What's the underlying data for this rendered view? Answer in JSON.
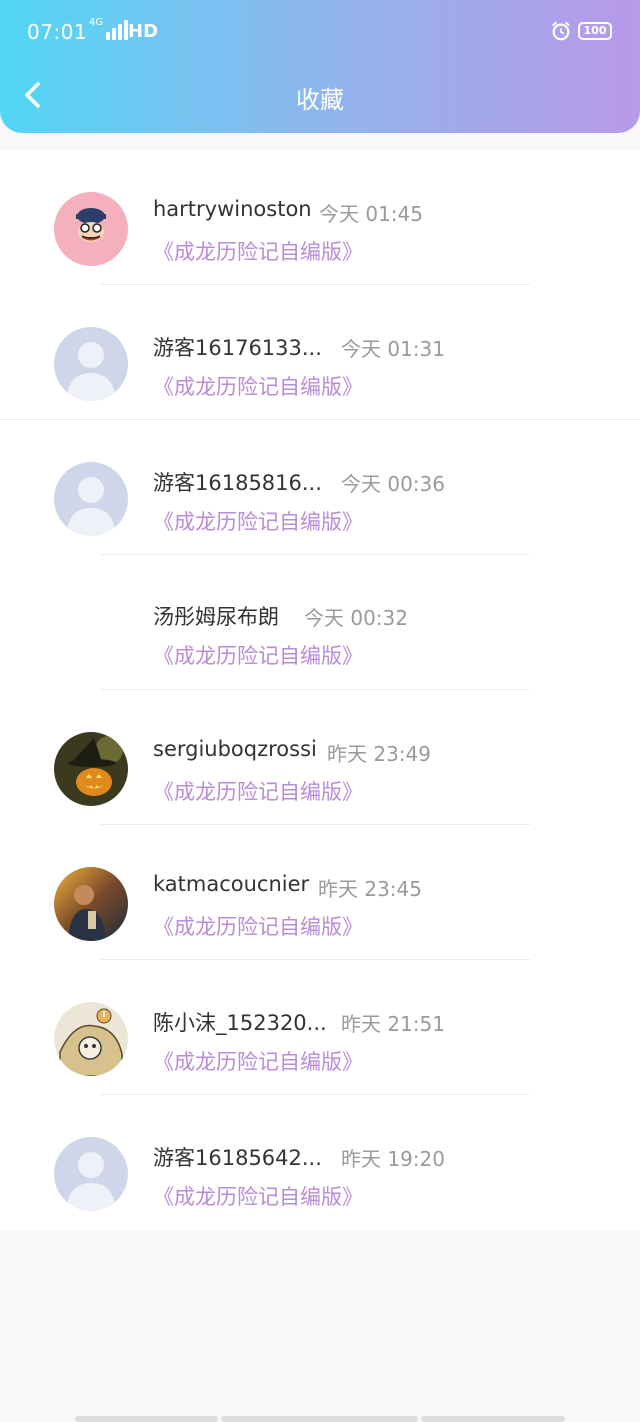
{
  "status_bar": {
    "time": "07:01",
    "network": "4G",
    "hd": "HD",
    "battery": "100"
  },
  "header": {
    "title": "收藏",
    "back_icon": "chevron-left-icon",
    "gradient_start": "#52d7f4",
    "gradient_end": "#b899ea"
  },
  "favorites": [
    {
      "name": "hartrywinoston",
      "time": "今天 01:45",
      "book": "《成龙历险记自编版》",
      "avatar": "cartoon-monkey-avatar"
    },
    {
      "name": "游客16176133...",
      "time": "今天 01:31",
      "book": "《成龙历险记自编版》",
      "avatar": "default-user-avatar"
    },
    {
      "name": "游客16185816...",
      "time": "今天 00:36",
      "book": "《成龙历险记自编版》",
      "avatar": "default-user-avatar"
    },
    {
      "name": "汤彤姆尿布朗",
      "time": "今天 00:32",
      "book": "《成龙历险记自编版》",
      "avatar": ""
    },
    {
      "name": "sergiuboqzrossi",
      "time": "昨天 23:49",
      "book": "《成龙历险记自编版》",
      "avatar": "pumpkin-witch-avatar"
    },
    {
      "name": "katmacoucnier",
      "time": "昨天 23:45",
      "book": "《成龙历险记自编版》",
      "avatar": "photo-person-avatar"
    },
    {
      "name": "陈小沫_152320...",
      "time": "昨天 21:51",
      "book": "《成龙历险记自编版》",
      "avatar": "sketch-cartoon-avatar"
    },
    {
      "name": "游客16185642...",
      "time": "昨天 19:20",
      "book": "《成龙历险记自编版》",
      "avatar": "default-user-avatar"
    }
  ],
  "colors": {
    "book_title": "#b98bd8",
    "time_text": "#9a9a9a",
    "name_text": "#333333"
  }
}
